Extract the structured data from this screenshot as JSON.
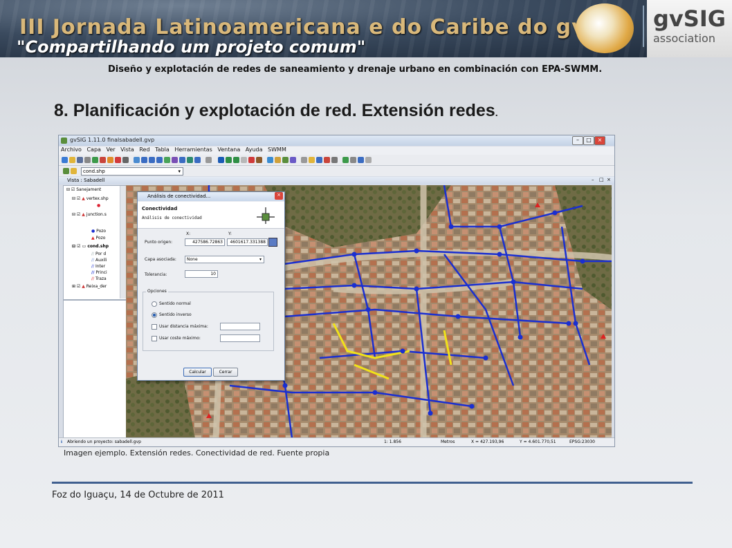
{
  "banner": {
    "title": "III Jornada Latinoamericana e do Caribe do gvSIG",
    "subtitle": "\"Compartilhando um projeto comum\"",
    "logo_name": "gvSIG",
    "logo_subtext": "association"
  },
  "slide": {
    "subtitle": "Diseño y explotación de redes de saneamiento y drenaje urbano en combinación con EPA-SWMM.",
    "heading": "8. Planificación y explotación de red. Extensión redes",
    "heading_suffix": ".",
    "caption": "Imagen ejemplo. Extensión redes. Conectividad de red. Fuente propia",
    "footer": "Foz do Iguaçu, 14 de Octubre de 2011"
  },
  "app": {
    "window_title": "gvSIG 1.11.0 finalsabadell.gvp",
    "menu": [
      "Archivo",
      "Capa",
      "Ver",
      "Vista",
      "Red",
      "Tabla",
      "Herramientas",
      "Ventana",
      "Ayuda",
      "SWMM"
    ],
    "layer_select": "cond.shp",
    "view_title": "Vista : Sabadell",
    "toc": {
      "root": "Sanejament",
      "layers": [
        {
          "name": "vertex.shp"
        },
        {
          "name": "junction.s"
        },
        {
          "legend": "Pozo"
        },
        {
          "legend": "Pozo"
        },
        {
          "name": "cond.shp"
        },
        {
          "legend": "Por d"
        },
        {
          "legend": "Auxili"
        },
        {
          "legend": "Inter"
        },
        {
          "legend": "Princi"
        },
        {
          "legend": "Traza"
        },
        {
          "name": "Reixa_der"
        }
      ]
    },
    "status": {
      "message": "Abriendo un proyecto: sabadell.gvp",
      "scale": "1: 1.856",
      "units": "Metros",
      "x": "X = 427.193,96",
      "y": "Y = 4.601.770,51",
      "epsg": "EPSG:23030"
    }
  },
  "dialog": {
    "title": "Análisis de conectividad...",
    "header_title": "Conectividad",
    "header_desc": "Análisis de conectividad",
    "x_label": "X:",
    "y_label": "Y:",
    "origin_label": "Punto origen:",
    "origin_x": "427586.72863",
    "origin_y": "4601617.331388",
    "layer_label": "Capa asociada:",
    "layer_value": "None",
    "tolerance_label": "Tolerancia:",
    "tolerance_value": "10",
    "options_label": "Opciones",
    "radio_normal": "Sentido normal",
    "radio_inverse": "Sentido inverso",
    "chk_distance": "Usar distancia máxima:",
    "chk_cost": "Usar coste máximo:",
    "calc_button": "Calcular",
    "close_button": "Cerrar"
  },
  "colors": {
    "network_main": "#1a2fd1",
    "network_highlight": "#f0e21a",
    "heading_text": "#1a1a1a",
    "divider": "#3f5f8f"
  }
}
